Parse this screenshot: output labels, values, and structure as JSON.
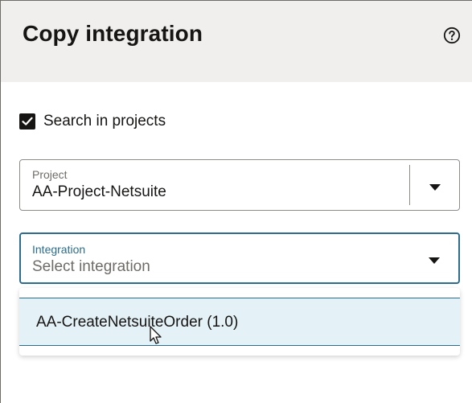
{
  "dialog": {
    "title": "Copy integration",
    "help_icon": "help-circle-icon"
  },
  "search_in_projects": {
    "label": "Search in projects",
    "checked": true
  },
  "project_field": {
    "label": "Project",
    "value": "AA-Project-Netsuite",
    "icon": "chevron-down-icon"
  },
  "integration_field": {
    "label": "Integration",
    "placeholder": "Select integration",
    "icon": "chevron-down-icon"
  },
  "dropdown": {
    "options": [
      {
        "label": "AA-CreateNetsuiteOrder (1.0)",
        "highlighted": true
      }
    ]
  },
  "colors": {
    "accent": "#2c6d8d",
    "header_bg": "#f1efed",
    "option_highlight": "#e4f1f7",
    "text": "#161513",
    "muted_text": "#6f6c68"
  }
}
